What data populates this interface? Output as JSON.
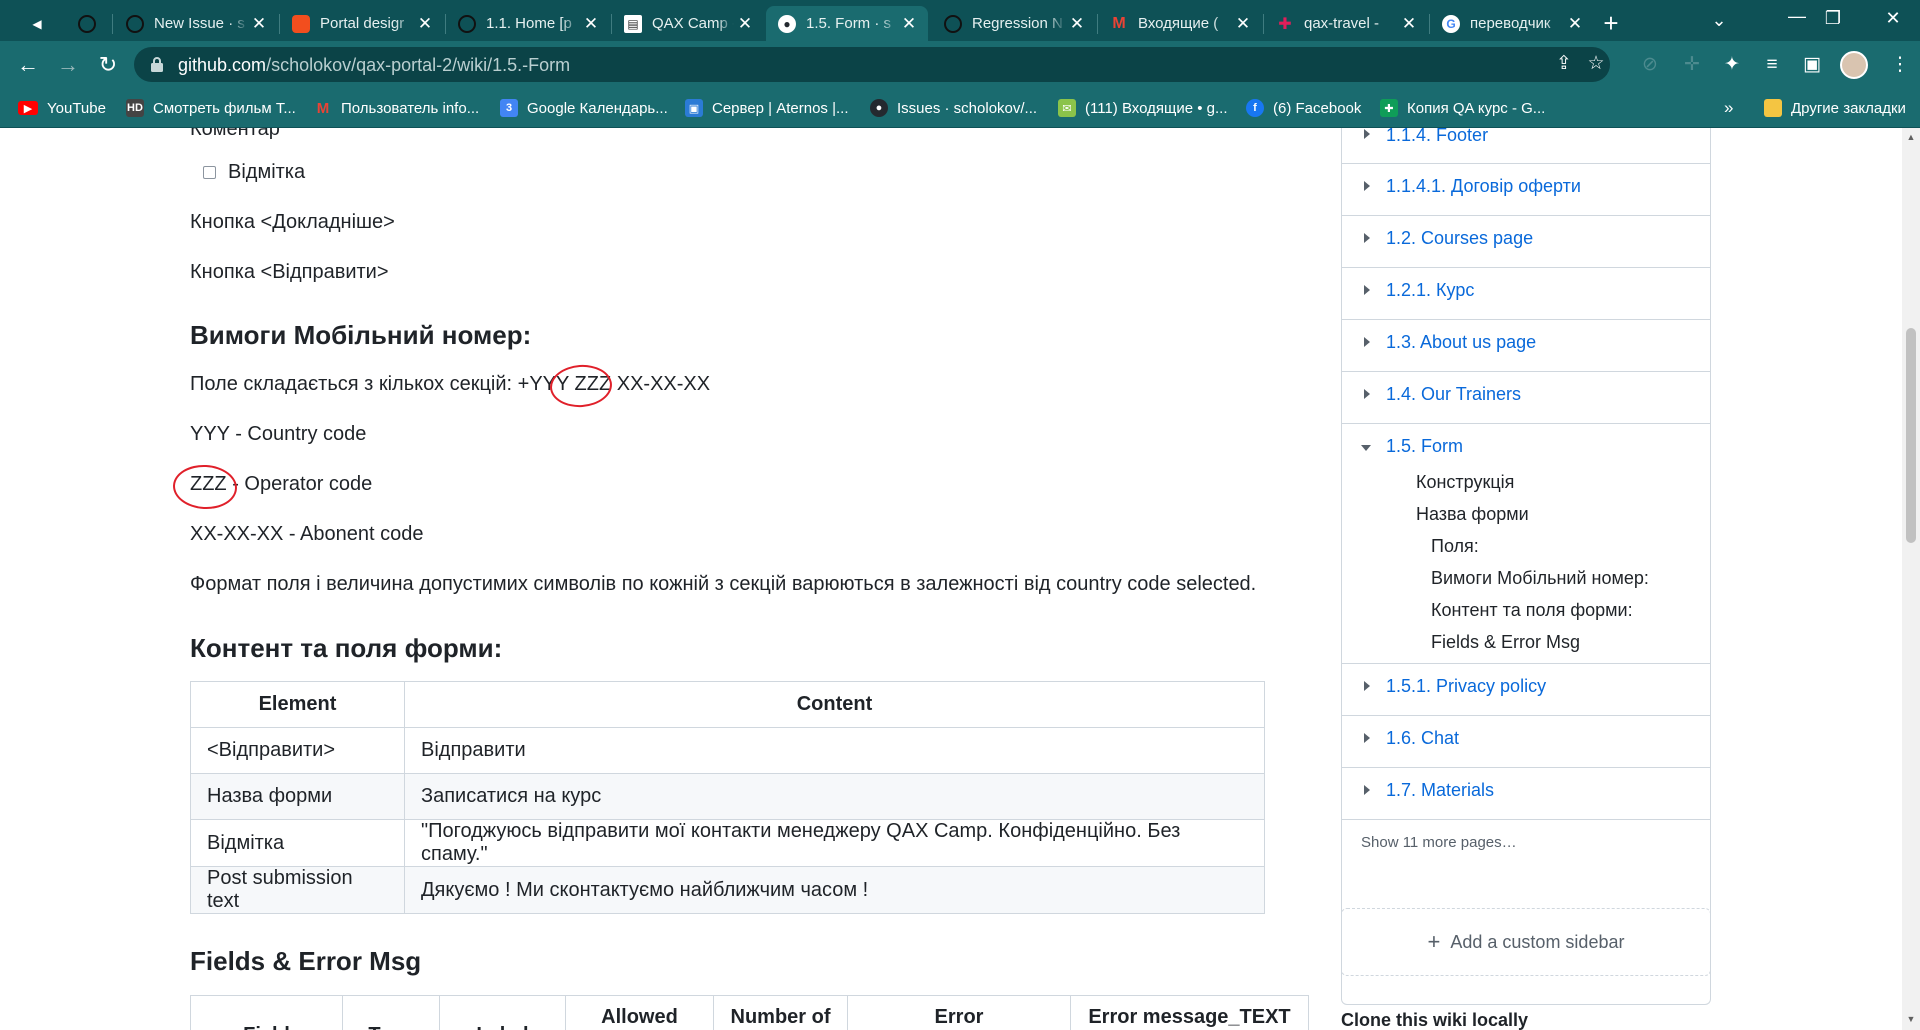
{
  "tabs": [
    {
      "title": "",
      "favicon": "speaker-icon"
    },
    {
      "title": "",
      "favicon": "github-icon"
    },
    {
      "title": "New Issue · s",
      "favicon": "github-icon"
    },
    {
      "title": "Portal desigr",
      "favicon": "figma-icon"
    },
    {
      "title": "1.1. Home [p",
      "favicon": "github-icon"
    },
    {
      "title": "QAX Camp - ",
      "favicon": "page-icon"
    },
    {
      "title": "1.5. Form · s",
      "favicon": "github-icon"
    },
    {
      "title": "Regression N",
      "favicon": "github-icon"
    },
    {
      "title": "Входящие (",
      "favicon": "gmail-icon"
    },
    {
      "title": "qax-travel - ",
      "favicon": "slack-icon"
    },
    {
      "title": "переводчик",
      "favicon": "google-icon"
    }
  ],
  "address": {
    "domain": "github.com",
    "path": "/scholokov/qax-portal-2/wiki/1.5.-Form"
  },
  "bookmarks": [
    {
      "label": "YouTube",
      "icon": "youtube-icon",
      "color": "#ff0000"
    },
    {
      "label": "Смотреть фильм Т...",
      "icon": "hd-icon",
      "color": "#444444"
    },
    {
      "label": "Пользователь info...",
      "icon": "gmail-icon",
      "color": "#ea4335"
    },
    {
      "label": "Google Календарь...",
      "icon": "calendar-icon",
      "color": "#4285f4"
    },
    {
      "label": "Сервер | Aternos |...",
      "icon": "aternos-icon",
      "color": "#2b7bd6"
    },
    {
      "label": "Issues · scholokov/...",
      "icon": "github-icon",
      "color": "#24292f"
    },
    {
      "label": "(111) Входящие • g...",
      "icon": "inbox-icon",
      "color": "#8bc34a"
    },
    {
      "label": "(6) Facebook",
      "icon": "facebook-icon",
      "color": "#1877f2"
    },
    {
      "label": "Копия QA курс - G...",
      "icon": "sheets-icon",
      "color": "#0f9d58"
    }
  ],
  "bookmarks_more": "»",
  "bookmarks_other": "Другие закладки",
  "content": {
    "partial_heading": "Коментар",
    "checkbox_label": "Відмітка",
    "btn_more": "Кнопка <Докладніше>",
    "btn_send": "Кнопка <Відправити>",
    "h_phone": "Вимоги Мобільний номер:",
    "phone_intro": "Поле складається з кількох секцій: +YYY ZZZ XX-XX-XX",
    "yyy": "YYY - Country code",
    "zzz": "ZZZ - Operator code",
    "xx": "XX-XX-XX - Abonent code",
    "format": "Формат поля і величина допустимих символів по кожній з секцій варюються в залежності від country code selected.",
    "h_content": "Контент та поля форми:",
    "table_headers": [
      "Element",
      "Content"
    ],
    "table_rows": [
      [
        "<Відправити>",
        "Відправити"
      ],
      [
        "Назва форми",
        "Записатися на курс"
      ],
      [
        "Відмітка",
        "\"Погоджуюсь відправити мої контакти менеджеру QAX Camp. Конфіденційно. Без спаму.\""
      ],
      [
        "Post submission text",
        "Дякуємо ! Ми сконтактуємо найближчим часом !"
      ]
    ],
    "h_fields": "Fields & Error Msg",
    "fields_headers": [
      "Field",
      "Type",
      "Label",
      "Allowed",
      "Number of",
      "Error",
      "Error message_TEXT"
    ]
  },
  "sidebar": {
    "items": [
      {
        "label": "1.1.4. Footer",
        "open": false
      },
      {
        "label": "1.1.4.1. Договір оферти",
        "open": false
      },
      {
        "label": "1.2. Courses page",
        "open": false
      },
      {
        "label": "1.2.1. Курс",
        "open": false
      },
      {
        "label": "1.3. About us page",
        "open": false
      },
      {
        "label": "1.4. Our Trainers",
        "open": false
      },
      {
        "label": "1.5. Form",
        "open": true
      }
    ],
    "sub": [
      "Конструкція",
      "Назва форми",
      "Поля:",
      "Вимоги Мобільний номер:",
      "Контент та поля форми:",
      "Fields & Error Msg"
    ],
    "items_after": [
      {
        "label": "1.5.1. Privacy policy"
      },
      {
        "label": "1.6. Chat"
      },
      {
        "label": "1.7. Materials"
      }
    ],
    "show_more": "Show 11 more pages…",
    "custom_sidebar": "Add a custom sidebar",
    "clone": "Clone this wiki locally"
  },
  "colors": {
    "tab_bg": "#0e5156",
    "toolbar_bg": "#1a6b6f",
    "link": "#0969da",
    "annotation": "#e0202a"
  }
}
